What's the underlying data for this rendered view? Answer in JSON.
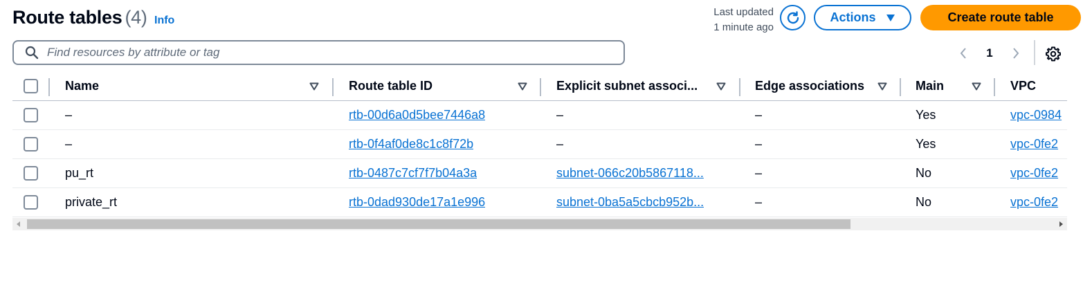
{
  "header": {
    "title": "Route tables",
    "count": "(4)",
    "info": "Info",
    "last_updated_line1": "Last updated",
    "last_updated_line2": "1 minute ago",
    "actions_label": "Actions",
    "create_label": "Create route table"
  },
  "search": {
    "placeholder": "Find resources by attribute or tag",
    "value": ""
  },
  "pagination": {
    "current_page": "1"
  },
  "table": {
    "columns": [
      "Name",
      "Route table ID",
      "Explicit subnet associ...",
      "Edge associations",
      "Main",
      "VPC"
    ],
    "rows": [
      {
        "name": "–",
        "id": "rtb-00d6a0d5bee7446a8",
        "subnet": "–",
        "edge": "–",
        "main": "Yes",
        "vpc": "vpc-0984"
      },
      {
        "name": "–",
        "id": "rtb-0f4af0de8c1c8f72b",
        "subnet": "–",
        "edge": "–",
        "main": "Yes",
        "vpc": "vpc-0fe2"
      },
      {
        "name": "pu_rt",
        "id": "rtb-0487c7cf7f7b04a3a",
        "subnet": "subnet-066c20b5867118...",
        "edge": "–",
        "main": "No",
        "vpc": "vpc-0fe2"
      },
      {
        "name": "private_rt",
        "id": "rtb-0dad930de17a1e996",
        "subnet": "subnet-0ba5a5cbcb952b...",
        "edge": "–",
        "main": "No",
        "vpc": "vpc-0fe2"
      }
    ]
  },
  "colors": {
    "link": "#0972d3",
    "primary": "#ff9900",
    "text": "#000716",
    "muted": "#5f6b7a"
  }
}
